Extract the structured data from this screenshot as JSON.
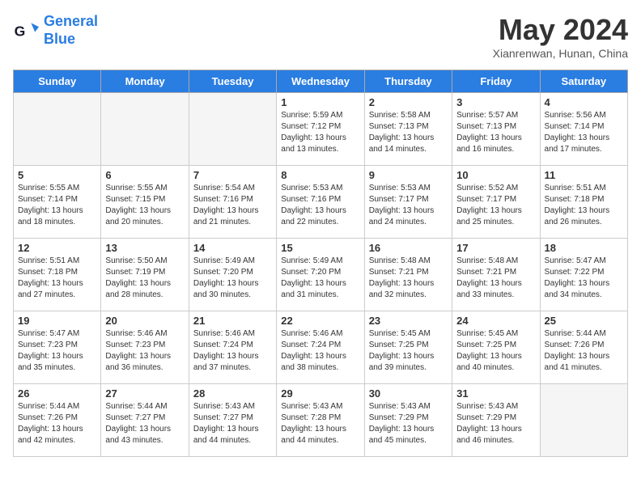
{
  "header": {
    "logo_line1": "General",
    "logo_line2": "Blue",
    "month_title": "May 2024",
    "location": "Xianrenwan, Hunan, China"
  },
  "weekdays": [
    "Sunday",
    "Monday",
    "Tuesday",
    "Wednesday",
    "Thursday",
    "Friday",
    "Saturday"
  ],
  "weeks": [
    [
      {
        "day": "",
        "info": ""
      },
      {
        "day": "",
        "info": ""
      },
      {
        "day": "",
        "info": ""
      },
      {
        "day": "1",
        "info": "Sunrise: 5:59 AM\nSunset: 7:12 PM\nDaylight: 13 hours\nand 13 minutes."
      },
      {
        "day": "2",
        "info": "Sunrise: 5:58 AM\nSunset: 7:13 PM\nDaylight: 13 hours\nand 14 minutes."
      },
      {
        "day": "3",
        "info": "Sunrise: 5:57 AM\nSunset: 7:13 PM\nDaylight: 13 hours\nand 16 minutes."
      },
      {
        "day": "4",
        "info": "Sunrise: 5:56 AM\nSunset: 7:14 PM\nDaylight: 13 hours\nand 17 minutes."
      }
    ],
    [
      {
        "day": "5",
        "info": "Sunrise: 5:55 AM\nSunset: 7:14 PM\nDaylight: 13 hours\nand 18 minutes."
      },
      {
        "day": "6",
        "info": "Sunrise: 5:55 AM\nSunset: 7:15 PM\nDaylight: 13 hours\nand 20 minutes."
      },
      {
        "day": "7",
        "info": "Sunrise: 5:54 AM\nSunset: 7:16 PM\nDaylight: 13 hours\nand 21 minutes."
      },
      {
        "day": "8",
        "info": "Sunrise: 5:53 AM\nSunset: 7:16 PM\nDaylight: 13 hours\nand 22 minutes."
      },
      {
        "day": "9",
        "info": "Sunrise: 5:53 AM\nSunset: 7:17 PM\nDaylight: 13 hours\nand 24 minutes."
      },
      {
        "day": "10",
        "info": "Sunrise: 5:52 AM\nSunset: 7:17 PM\nDaylight: 13 hours\nand 25 minutes."
      },
      {
        "day": "11",
        "info": "Sunrise: 5:51 AM\nSunset: 7:18 PM\nDaylight: 13 hours\nand 26 minutes."
      }
    ],
    [
      {
        "day": "12",
        "info": "Sunrise: 5:51 AM\nSunset: 7:18 PM\nDaylight: 13 hours\nand 27 minutes."
      },
      {
        "day": "13",
        "info": "Sunrise: 5:50 AM\nSunset: 7:19 PM\nDaylight: 13 hours\nand 28 minutes."
      },
      {
        "day": "14",
        "info": "Sunrise: 5:49 AM\nSunset: 7:20 PM\nDaylight: 13 hours\nand 30 minutes."
      },
      {
        "day": "15",
        "info": "Sunrise: 5:49 AM\nSunset: 7:20 PM\nDaylight: 13 hours\nand 31 minutes."
      },
      {
        "day": "16",
        "info": "Sunrise: 5:48 AM\nSunset: 7:21 PM\nDaylight: 13 hours\nand 32 minutes."
      },
      {
        "day": "17",
        "info": "Sunrise: 5:48 AM\nSunset: 7:21 PM\nDaylight: 13 hours\nand 33 minutes."
      },
      {
        "day": "18",
        "info": "Sunrise: 5:47 AM\nSunset: 7:22 PM\nDaylight: 13 hours\nand 34 minutes."
      }
    ],
    [
      {
        "day": "19",
        "info": "Sunrise: 5:47 AM\nSunset: 7:23 PM\nDaylight: 13 hours\nand 35 minutes."
      },
      {
        "day": "20",
        "info": "Sunrise: 5:46 AM\nSunset: 7:23 PM\nDaylight: 13 hours\nand 36 minutes."
      },
      {
        "day": "21",
        "info": "Sunrise: 5:46 AM\nSunset: 7:24 PM\nDaylight: 13 hours\nand 37 minutes."
      },
      {
        "day": "22",
        "info": "Sunrise: 5:46 AM\nSunset: 7:24 PM\nDaylight: 13 hours\nand 38 minutes."
      },
      {
        "day": "23",
        "info": "Sunrise: 5:45 AM\nSunset: 7:25 PM\nDaylight: 13 hours\nand 39 minutes."
      },
      {
        "day": "24",
        "info": "Sunrise: 5:45 AM\nSunset: 7:25 PM\nDaylight: 13 hours\nand 40 minutes."
      },
      {
        "day": "25",
        "info": "Sunrise: 5:44 AM\nSunset: 7:26 PM\nDaylight: 13 hours\nand 41 minutes."
      }
    ],
    [
      {
        "day": "26",
        "info": "Sunrise: 5:44 AM\nSunset: 7:26 PM\nDaylight: 13 hours\nand 42 minutes."
      },
      {
        "day": "27",
        "info": "Sunrise: 5:44 AM\nSunset: 7:27 PM\nDaylight: 13 hours\nand 43 minutes."
      },
      {
        "day": "28",
        "info": "Sunrise: 5:43 AM\nSunset: 7:27 PM\nDaylight: 13 hours\nand 44 minutes."
      },
      {
        "day": "29",
        "info": "Sunrise: 5:43 AM\nSunset: 7:28 PM\nDaylight: 13 hours\nand 44 minutes."
      },
      {
        "day": "30",
        "info": "Sunrise: 5:43 AM\nSunset: 7:29 PM\nDaylight: 13 hours\nand 45 minutes."
      },
      {
        "day": "31",
        "info": "Sunrise: 5:43 AM\nSunset: 7:29 PM\nDaylight: 13 hours\nand 46 minutes."
      },
      {
        "day": "",
        "info": ""
      }
    ]
  ]
}
